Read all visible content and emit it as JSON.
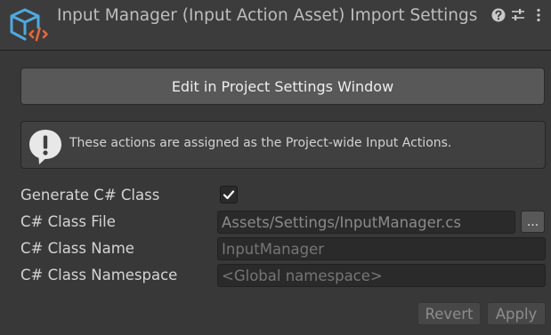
{
  "header": {
    "title": "Input Manager (Input Action Asset) Import Settings",
    "icons": [
      "input-action-asset-icon",
      "help-icon",
      "preset-icon",
      "more-options-icon"
    ]
  },
  "main": {
    "edit_button_label": "Edit in Project Settings Window",
    "help_message": "These actions are assigned as the Project-wide Input Actions.",
    "generate_label": "Generate C# Class",
    "generate_checked": true,
    "class_file_label": "C# Class File",
    "class_file_value": "Assets/Settings/InputManager.cs",
    "browse_label": "...",
    "class_name_label": "C# Class Name",
    "class_name_placeholder": "InputManager",
    "namespace_label": "C# Class Namespace",
    "namespace_placeholder": "<Global namespace>"
  },
  "footer": {
    "revert_label": "Revert",
    "apply_label": "Apply"
  },
  "colors": {
    "asset_icon_blue": "#4fa9e0",
    "asset_icon_orange": "#e8663a",
    "background": "#383838",
    "button": "#585858"
  }
}
